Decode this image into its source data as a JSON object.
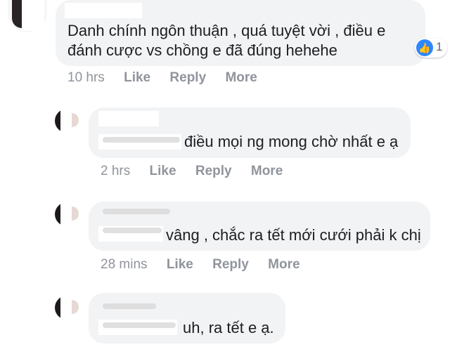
{
  "comments": [
    {
      "text_lines": [
        "Danh chính ngôn thuận , quá tuyệt vời , điều e",
        "đánh cược vs chồng e đã đúng hehehe"
      ],
      "time": "10 hrs",
      "like": "Like",
      "reply": "Reply",
      "more": "More",
      "reactions": "1",
      "reaction_icon": "thumbs-up-icon"
    },
    {
      "text": "điều mọi ng mong chờ nhất e ạ",
      "time": "2 hrs",
      "like": "Like",
      "reply": "Reply",
      "more": "More"
    },
    {
      "text": "vâng , chắc ra tết mới cưới phải k chị",
      "time": "28 mins",
      "like": "Like",
      "reply": "Reply",
      "more": "More"
    },
    {
      "text": "uh, ra tết e ạ."
    }
  ],
  "colors": {
    "bubble": "#f2f3f5",
    "meta": "#90949c",
    "like_blue": "#2d88ff"
  }
}
